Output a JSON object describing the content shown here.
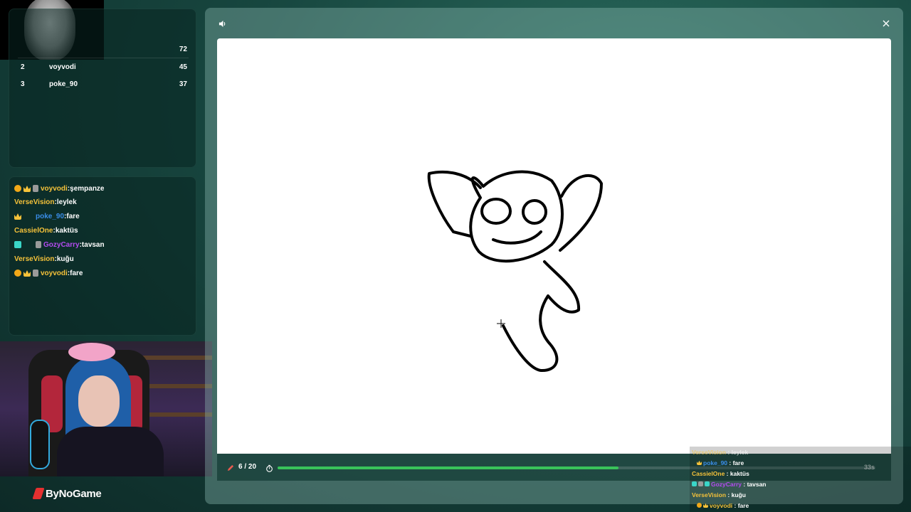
{
  "leaderboard": {
    "rows": [
      {
        "rank": "",
        "name": "",
        "score": "72"
      },
      {
        "rank": "2",
        "name": "voyvodi",
        "score": "45"
      },
      {
        "rank": "3",
        "name": "poke_90",
        "score": "37"
      }
    ]
  },
  "chat": {
    "messages": [
      {
        "user": "voyvodi",
        "text": "şempanze",
        "color": "#f5c23a",
        "badges": [
          "round",
          "crown",
          "sword"
        ]
      },
      {
        "user": "VerseVision",
        "text": "leylek",
        "color": "#f5c23a",
        "badges": []
      },
      {
        "user": "poke_90",
        "text": "fare",
        "color": "#3a8de8",
        "badges": [
          "crown",
          "blank"
        ]
      },
      {
        "user": "CassielOne",
        "text": "kaktüs",
        "color": "#f5c23a",
        "badges": []
      },
      {
        "user": "GozyCarry",
        "text": "tavsan",
        "color": "#b44bf0",
        "badges": [
          "gift",
          "blank",
          "sword"
        ]
      },
      {
        "user": "VerseVision",
        "text": "kuğu",
        "color": "#f5c23a",
        "badges": []
      },
      {
        "user": "voyvodi",
        "text": "fare",
        "color": "#f5c23a",
        "badges": [
          "round",
          "crown",
          "sword"
        ]
      }
    ]
  },
  "brand": {
    "name": "ByNoGame",
    "accent": "#e53030"
  },
  "game": {
    "round": "6 / 20",
    "progress": 0.57,
    "timer": "33s",
    "progress_color": "#39c35a"
  },
  "overlay_chat": {
    "messages": [
      {
        "user": "VerseVision",
        "text": "leylek",
        "color": "#f5c23a"
      },
      {
        "user": "poke_90",
        "text": "fare",
        "color": "#3a8de8"
      },
      {
        "user": "CassielOne",
        "text": "kaktüs",
        "color": "#f5c23a"
      },
      {
        "user": "GozyCarry",
        "text": "tavsan",
        "color": "#b44bf0"
      },
      {
        "user": "VerseVision",
        "text": "kuğu",
        "color": "#f5c23a"
      },
      {
        "user": "voyvodi",
        "text": "fare",
        "color": "#f5c23a"
      }
    ]
  },
  "icons": {
    "volume": "speaker-icon",
    "close": "close-icon",
    "pencil": "pencil-icon",
    "timer": "stopwatch-icon"
  }
}
